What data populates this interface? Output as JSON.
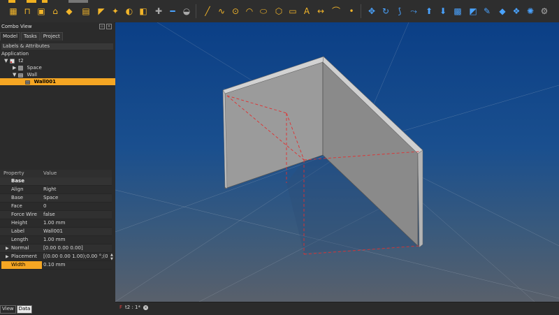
{
  "combo_view": {
    "title": "Combo View",
    "tabs": [
      "Model",
      "Tasks",
      "Project"
    ],
    "labels_attributes": "Labels & Attributes"
  },
  "tree": [
    {
      "label": "Application",
      "level": 0,
      "arrow": ""
    },
    {
      "label": "t2",
      "level": 1,
      "arrow": "▼",
      "icon": "document-icon"
    },
    {
      "label": "Space",
      "level": 2,
      "arrow": "▶",
      "icon": "space-icon"
    },
    {
      "label": "Wall",
      "level": 2,
      "arrow": "▼",
      "icon": "wall-icon"
    },
    {
      "label": "Wall001",
      "level": 3,
      "arrow": "",
      "icon": "wall-icon",
      "selected": true
    }
  ],
  "properties": {
    "header_property": "Property",
    "header_value": "Value",
    "group": "Base",
    "rows": [
      {
        "name": "Align",
        "value": "Right"
      },
      {
        "name": "Base",
        "value": "Space"
      },
      {
        "name": "Face",
        "value": "0"
      },
      {
        "name": "Force Wire",
        "value": "false"
      },
      {
        "name": "Height",
        "value": "1.00 mm"
      },
      {
        "name": "Label",
        "value": "Wall001"
      },
      {
        "name": "Length",
        "value": "1.00 mm"
      },
      {
        "name": "Normal",
        "value": "[0.00 0.00 0.00]",
        "expandable": true
      },
      {
        "name": "Placement",
        "value": "[(0.00 0.00 1.00);0.00 °;(0...",
        "expandable": true
      },
      {
        "name": "Width",
        "value": "0.10 mm",
        "highlight": true
      }
    ]
  },
  "bottom_tabs": [
    "View",
    "Data"
  ],
  "document_tab": {
    "label": "t2 : 1*"
  },
  "colors": {
    "accent": "#f5a623",
    "viewport_top": "#0b3f86",
    "viewport_bottom": "#59606b",
    "wall_face": "#9e9e9e",
    "wall_top": "#d0d0d0",
    "dashed": "#e03030"
  }
}
